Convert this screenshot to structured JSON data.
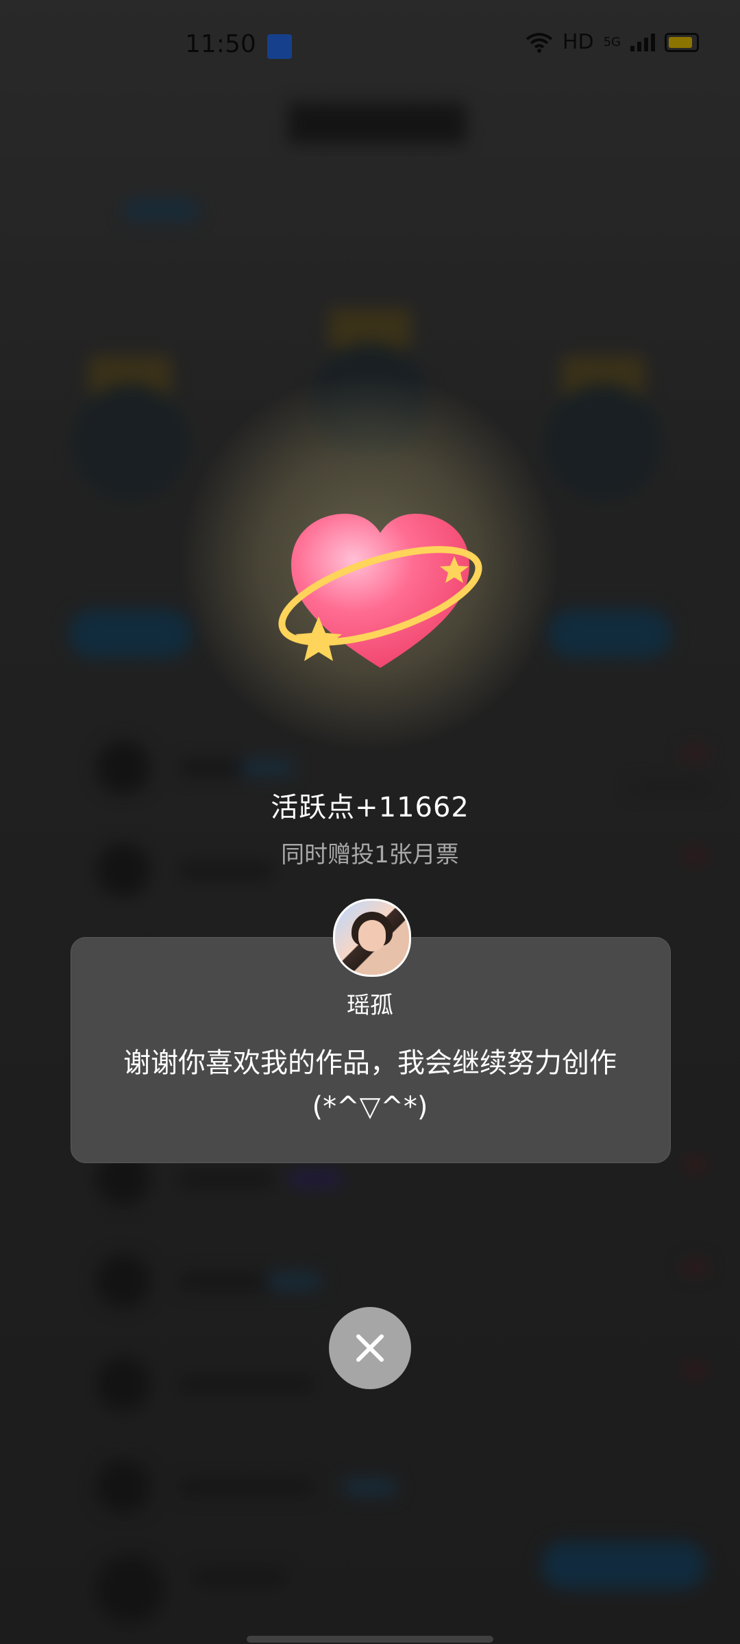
{
  "status_bar": {
    "time": "11:50",
    "hd_label": "HD",
    "network": "5G",
    "icons": [
      "app-notification-icon",
      "wifi-icon",
      "signal-icon",
      "battery-icon"
    ]
  },
  "gift_popup": {
    "active_points_text": "活跃点+11662",
    "ticket_text": "同时赠投1张月票",
    "author_name": "瑶孤",
    "thank_you_message": "谢谢你喜欢我的作品，我会继续努力创作(*^▽^*)",
    "close_icon": "close-icon",
    "heart_icon": "heart-icon",
    "colors": {
      "heart_pink": "#ff5b86",
      "ring_gold": "#ffd45a",
      "card_bg": "#4a4a4a",
      "close_bg": "#a6a6a6"
    }
  }
}
